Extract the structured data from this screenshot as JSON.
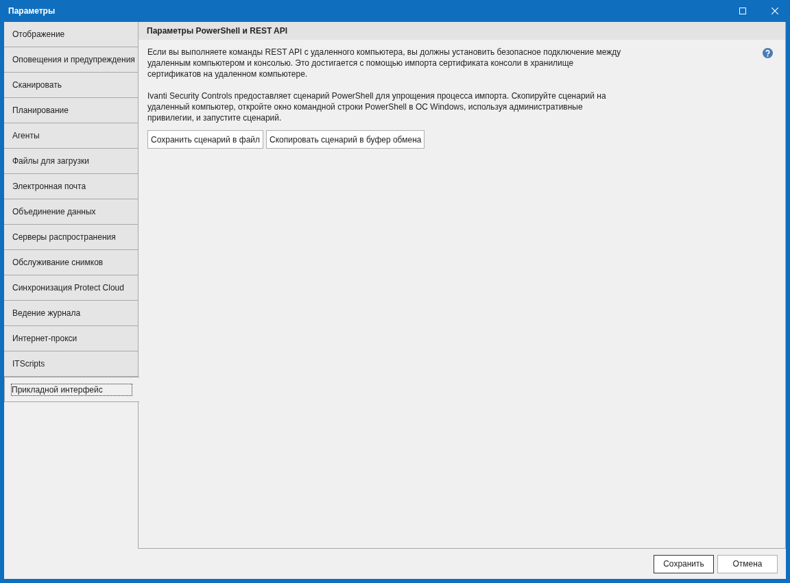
{
  "window": {
    "title": "Параметры"
  },
  "sidebar": {
    "items": [
      {
        "label": "Отображение",
        "selected": false
      },
      {
        "label": "Оповещения и предупреждения",
        "selected": false
      },
      {
        "label": "Сканировать",
        "selected": false
      },
      {
        "label": "Планирование",
        "selected": false
      },
      {
        "label": "Агенты",
        "selected": false
      },
      {
        "label": "Файлы для загрузки",
        "selected": false
      },
      {
        "label": "Электронная почта",
        "selected": false
      },
      {
        "label": "Объединение данных",
        "selected": false
      },
      {
        "label": "Серверы распространения",
        "selected": false
      },
      {
        "label": "Обслуживание снимков",
        "selected": false
      },
      {
        "label": "Синхронизация Protect Cloud",
        "selected": false
      },
      {
        "label": "Ведение журнала",
        "selected": false
      },
      {
        "label": "Интернет-прокси",
        "selected": false
      },
      {
        "label": "ITScripts",
        "selected": false
      },
      {
        "label": "Прикладной интерфейс",
        "selected": true
      }
    ]
  },
  "panel": {
    "title": "Параметры PowerShell и REST API",
    "paragraphs": [
      "Если вы выполняете команды REST API с удаленного компьютера, вы должны установить безопасное подключение между удаленным компьютером и консолью. Это достигается с помощью импорта сертификата консоли в хранилище сертификатов на удаленном компьютере.",
      "Ivanti Security Controls предоставляет сценарий PowerShell для упрощения процесса импорта. Скопируйте сценарий на удаленный компьютер, откройте окно командной строки PowerShell в ОС Windows, используя административные привилегии, и запустите сценарий."
    ],
    "buttons": [
      "Сохранить сценарий в файл",
      "Скопировать сценарий в буфер обмена"
    ]
  },
  "footer": {
    "buttons": [
      {
        "label": "Сохранить",
        "kind": "default"
      },
      {
        "label": "Отмена",
        "kind": "normal"
      }
    ]
  }
}
